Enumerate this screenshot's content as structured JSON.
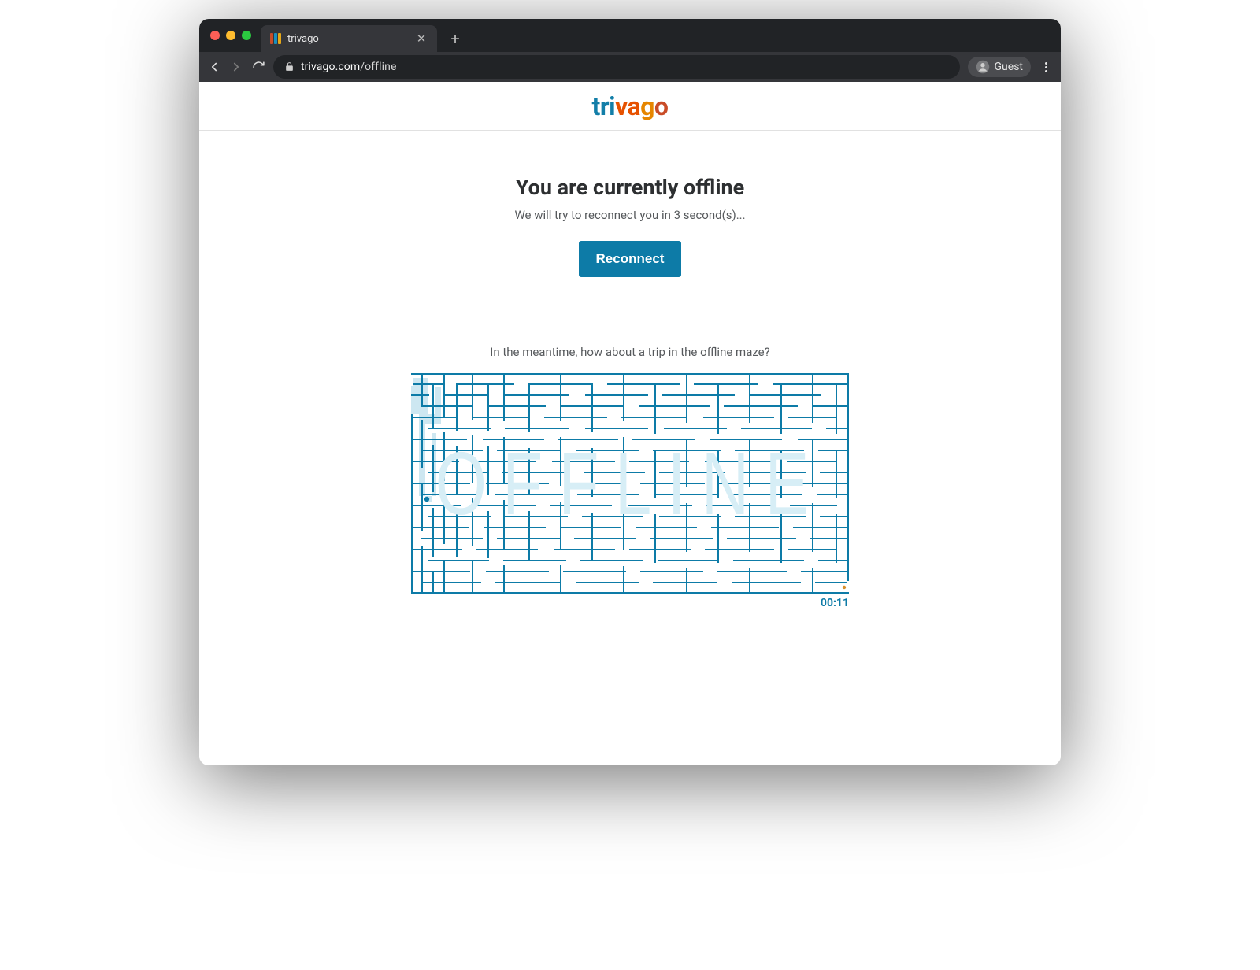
{
  "browser": {
    "tab_title": "trivago",
    "url_domain": "trivago.com",
    "url_path": "/offline",
    "guest_label": "Guest"
  },
  "logo": {
    "t": "t",
    "r": "r",
    "i": "i",
    "v": "v",
    "a": "a",
    "g": "g",
    "o": "o"
  },
  "offline": {
    "headline": "You are currently offline",
    "subline": "We will try to reconnect you in 3 second(s)...",
    "button": "Reconnect",
    "maze_intro": "In the meantime, how about a trip in the offline maze?",
    "maze_word": "OFFLINE",
    "timer": "00:11"
  },
  "colors": {
    "accent": "#0d7ba7",
    "logo_blue": "#127ea8",
    "logo_orange": "#e65100",
    "logo_amber": "#e68600",
    "logo_rust": "#c94c27"
  }
}
